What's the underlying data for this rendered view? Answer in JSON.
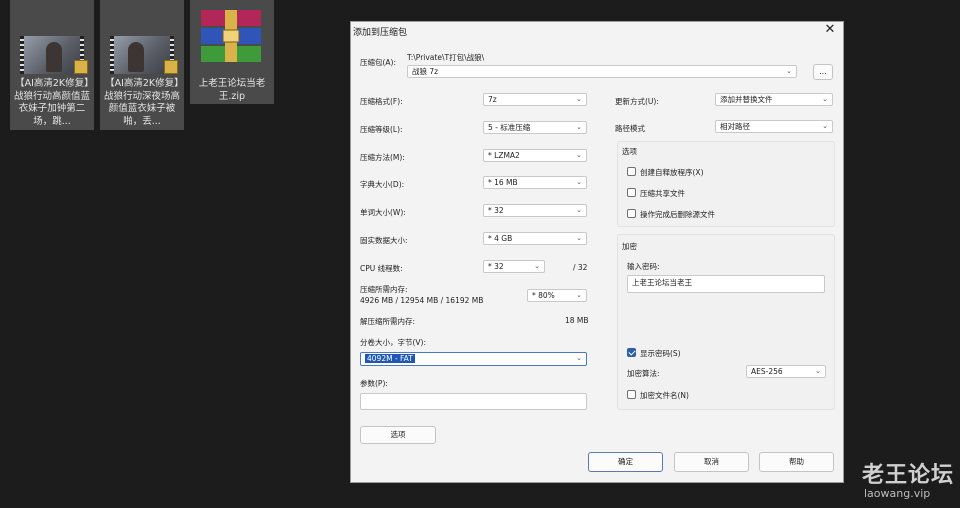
{
  "desktop": {
    "files": [
      {
        "label": "【AI高清2K修复】战狼行动高颜值蓝衣妹子加钟第二场，跳..."
      },
      {
        "label": "【AI高清2K修复】战狼行动深夜场高颜值蓝衣妹子被啪，丢..."
      },
      {
        "label": "上老王论坛当老王.zip"
      }
    ]
  },
  "dialog": {
    "title": "添加到压缩包",
    "close_glyph": "✕",
    "archive": {
      "label": "压缩包(A):",
      "path": "T:\\Private\\T打包\\战狼\\",
      "filename": "战狼 7z",
      "browse_label": "..."
    },
    "left": {
      "format": {
        "label": "压缩格式(F):",
        "value": "7z"
      },
      "level": {
        "label": "压缩等级(L):",
        "value": "5 - 标准压缩"
      },
      "method": {
        "label": "压缩方法(M):",
        "value": "* LZMA2"
      },
      "dict": {
        "label": "字典大小(D):",
        "value": "* 16 MB"
      },
      "word": {
        "label": "单词大小(W):",
        "value": "* 32"
      },
      "solid": {
        "label": "固实数据大小:",
        "value": "* 4 GB"
      },
      "cpu": {
        "label": "CPU 线程数:",
        "value": "* 32",
        "max": "/ 32"
      },
      "mem_compress": {
        "label": "压缩所需内存:",
        "detail": "4926 MB / 12954 MB / 16192 MB",
        "value": "* 80%"
      },
      "mem_decompress": {
        "label": "解压缩所需内存:",
        "value": "18 MB"
      },
      "volume": {
        "label": "分卷大小，字节(V):",
        "value": "4092M - FAT"
      },
      "params": {
        "label": "参数(P):",
        "value": ""
      },
      "options_button": "选项"
    },
    "right": {
      "update": {
        "label": "更新方式(U):",
        "value": "添加并替换文件"
      },
      "path_mode": {
        "label": "路径模式",
        "value": "相对路径"
      },
      "options_group": {
        "title": "选项",
        "items": [
          {
            "label": "创建自释放程序(X)",
            "checked": false
          },
          {
            "label": "压缩共享文件",
            "checked": false
          },
          {
            "label": "操作完成后删除源文件",
            "checked": false
          }
        ]
      },
      "encryption": {
        "title": "加密",
        "password_label": "输入密码:",
        "password_value": "上老王论坛当老王",
        "show_password": {
          "label": "显示密码(S)",
          "checked": true
        },
        "method_label": "加密算法:",
        "method_value": "AES-256",
        "encrypt_names": {
          "label": "加密文件名(N)",
          "checked": false
        }
      }
    },
    "buttons": {
      "ok": "确定",
      "cancel": "取消",
      "help": "帮助"
    }
  },
  "watermark": {
    "cn": "老王论坛",
    "en": "laowang.vip"
  },
  "colors": {
    "accent": "#2f5fa8",
    "selection": "#1f57b3",
    "desktop_bg": "#1c1c1c"
  }
}
